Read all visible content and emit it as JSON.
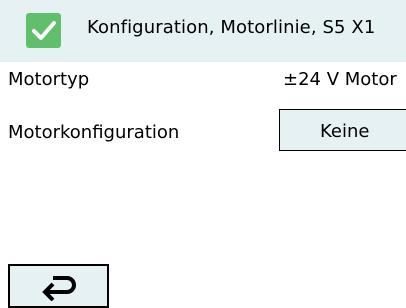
{
  "header": {
    "title": "Konfiguration, Motorlinie, S5 X1",
    "status_icon": "checkmark-icon",
    "colors": {
      "background": "#e6f1f4",
      "check": "#5fbf6b"
    }
  },
  "rows": [
    {
      "label": "Motortyp",
      "value": "±24 V Motor"
    },
    {
      "label": "Motorkonfiguration",
      "value": "Keine"
    }
  ],
  "footer": {
    "back_icon": "return-arrow-icon"
  }
}
